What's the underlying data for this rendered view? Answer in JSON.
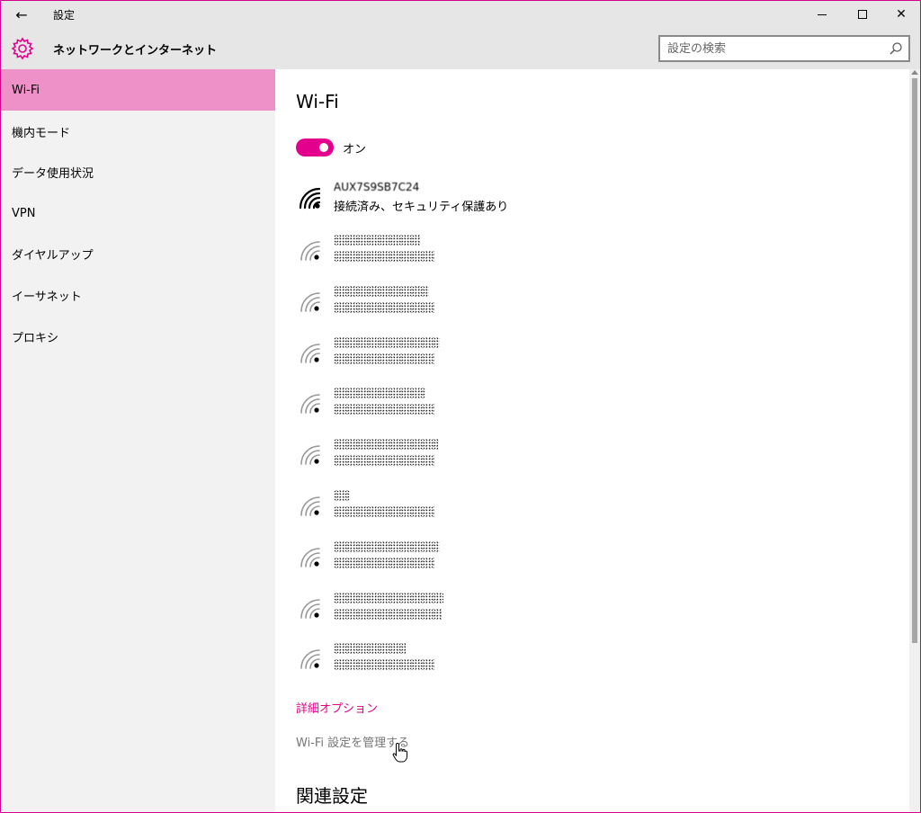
{
  "titlebar": {
    "back_icon": "back-arrow-icon",
    "title": "設定",
    "minimize_icon": "minimize-icon",
    "maximize_icon": "maximize-icon",
    "close_icon": "close-icon",
    "close_glyph": "✕",
    "back_glyph": "←"
  },
  "header": {
    "icon": "gear-icon",
    "title": "ネットワークとインターネット",
    "search_placeholder": "設定の検索",
    "search_icon": "search-icon",
    "accent_color": "#e3008c"
  },
  "sidebar": {
    "items": [
      {
        "label": "Wi-Fi",
        "active": true
      },
      {
        "label": "機内モード",
        "active": false
      },
      {
        "label": "データ使用状況",
        "active": false
      },
      {
        "label": "VPN",
        "active": false
      },
      {
        "label": "ダイヤルアップ",
        "active": false
      },
      {
        "label": "イーサネット",
        "active": false
      },
      {
        "label": "プロキシ",
        "active": false
      }
    ],
    "active_color": "#ee91c8"
  },
  "main": {
    "title": "Wi-Fi",
    "toggle_label": "オン",
    "toggle_on": true,
    "connected_network": {
      "ssid": "AUX7S9SB7C24",
      "status": "接続済み、セキュリティ保護あり",
      "icon": "wifi-full-icon"
    },
    "other_networks_icon": "wifi-weak-icon",
    "advanced_link": "詳細オプション",
    "manage_link": "Wi-Fi 設定を管理する",
    "related_title": "関連設定",
    "cursor_icon": "hand-pointer-icon"
  }
}
